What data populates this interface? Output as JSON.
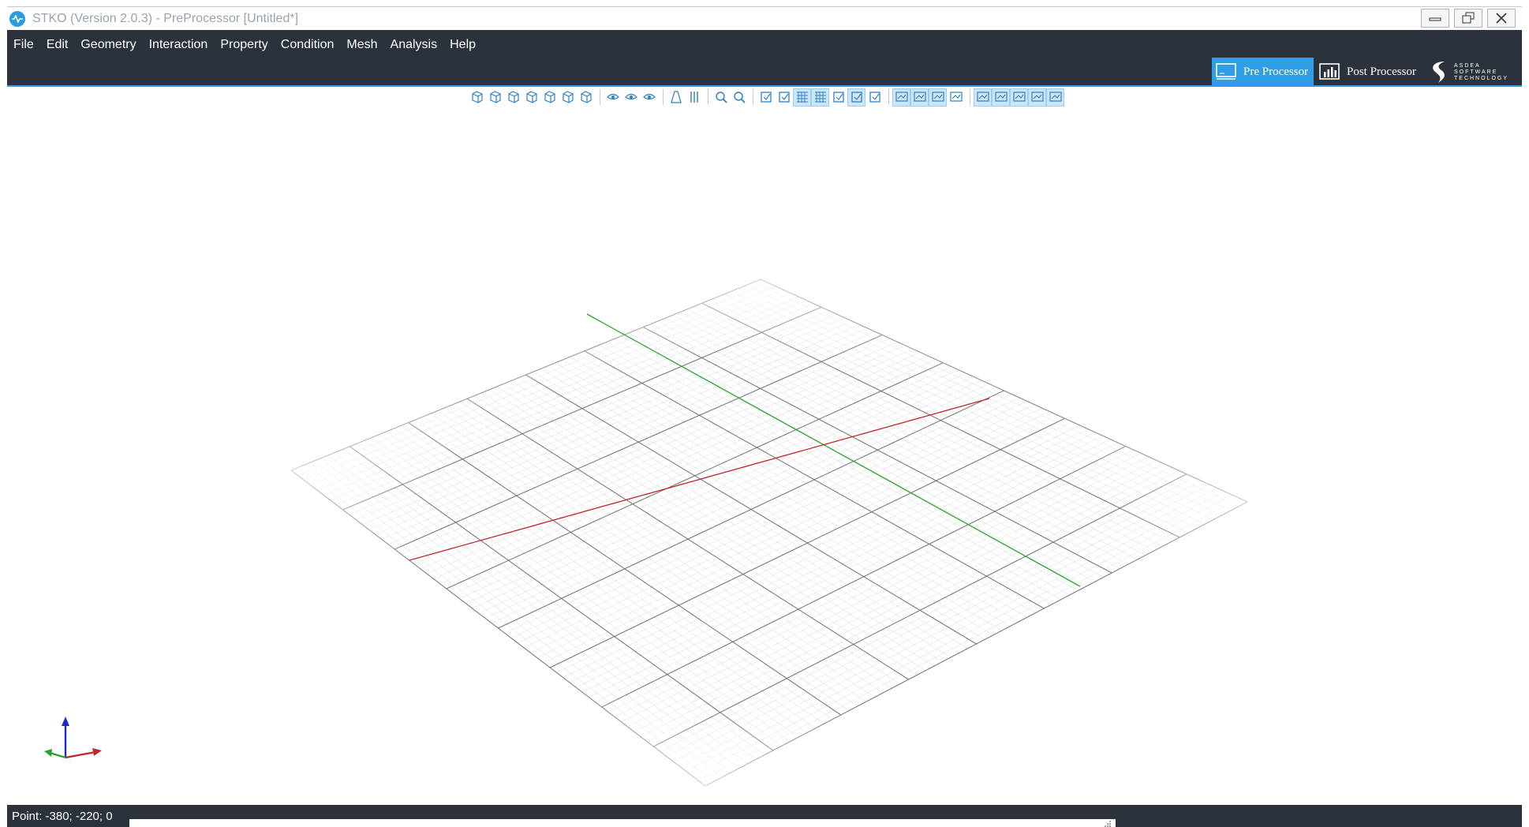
{
  "window": {
    "title": "STKO (Version 2.0.3) - PreProcessor [Untitled*]"
  },
  "title_controls": [
    "minimize-icon",
    "restore-icon",
    "close-icon"
  ],
  "menu": [
    "File",
    "Edit",
    "Geometry",
    "Interaction",
    "Property",
    "Condition",
    "Mesh",
    "Analysis",
    "Help"
  ],
  "modes": {
    "pre": "Pre Processor",
    "post": "Post Processor",
    "active": "pre"
  },
  "brand": {
    "line1": "ASDEA",
    "line2": "SOFTWARE",
    "line3": "TECHNOLOGY"
  },
  "toolbar_groups": [
    [
      "view-iso-icon",
      "view-front-icon",
      "view-back-icon",
      "view-left-icon",
      "view-right-icon",
      "view-top-icon",
      "view-bottom-icon"
    ],
    [
      "eye-icon",
      "eye-half-icon",
      "eye-hide-icon"
    ],
    [
      "perspective-icon",
      "parallel-icon"
    ],
    [
      "zoom-fit-icon",
      "zoom-icon"
    ],
    [
      "screenshot-icon",
      "pick-icon",
      "grid-icon",
      "grid-snap-icon",
      "axes-icon",
      "select-box-icon",
      "select-add-icon"
    ],
    [
      "render-wire-icon",
      "render-solid-icon",
      "render-shaded-icon",
      "render-points-icon"
    ],
    [
      "filter-vertex-icon",
      "filter-edge-icon",
      "filter-face-icon",
      "filter-solid-icon",
      "filter-all-icon"
    ]
  ],
  "status": {
    "text": "Point: -380; -220; 0"
  },
  "colors": {
    "accent": "#2e9fe6",
    "bar": "#2c323c",
    "x_axis": "#c0262a",
    "y_axis": "#2da32d",
    "z_axis": "#1b2fc8"
  }
}
